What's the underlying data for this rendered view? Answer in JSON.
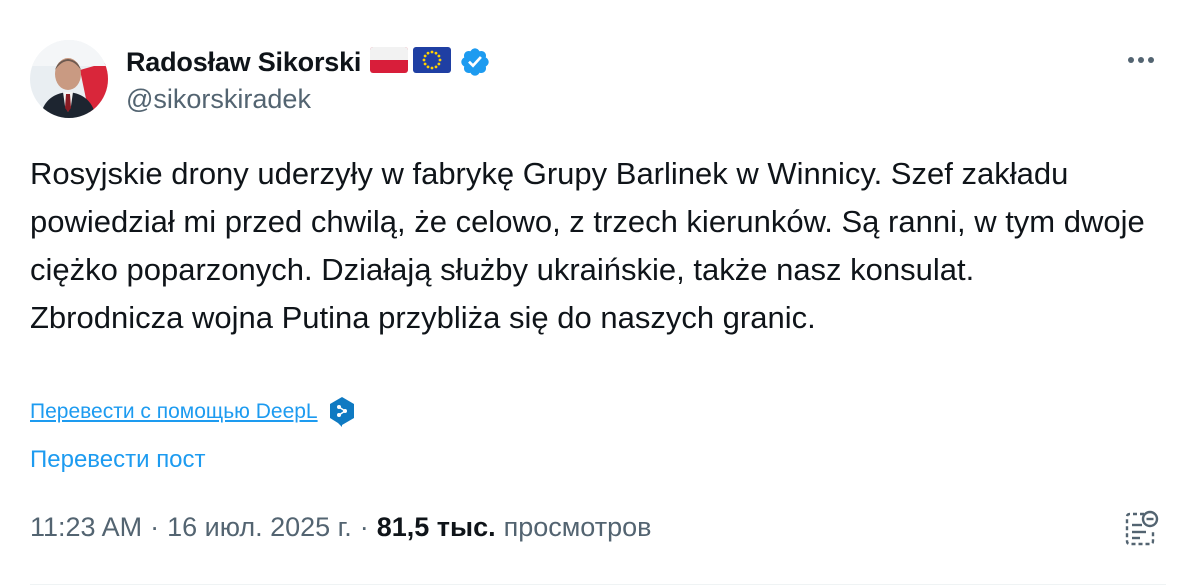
{
  "author": {
    "display_name": "Radosław Sikorski",
    "handle": "@sikorskiradek",
    "flags": [
      "poland-flag",
      "eu-flag"
    ],
    "verified": true
  },
  "tweet": {
    "paragraphs": [
      "Rosyjskie drony uderzyły w fabrykę Grupy Barlinek w Winnicy. Szef zakładu powiedział mi przed chwilą, że celowo, z trzech kierunków. Są ranni, w tym dwoje ciężko poparzonych. Działają służby ukraińskie, także nasz konsulat.",
      "Zbrodnicza wojna Putina przybliża się do naszych granic."
    ],
    "translate_deepl_label": "Перевести с помощью DeepL",
    "translate_post_label": "Перевести пост"
  },
  "meta": {
    "time": "11:23 AM",
    "date": "16 июл. 2025 г.",
    "views_count": "81,5 тыс.",
    "views_label": "просмотров"
  },
  "colors": {
    "accent": "#1d9bf0",
    "text": "#0f1419",
    "secondary": "#536471",
    "deepl": "#0f7ac2"
  }
}
